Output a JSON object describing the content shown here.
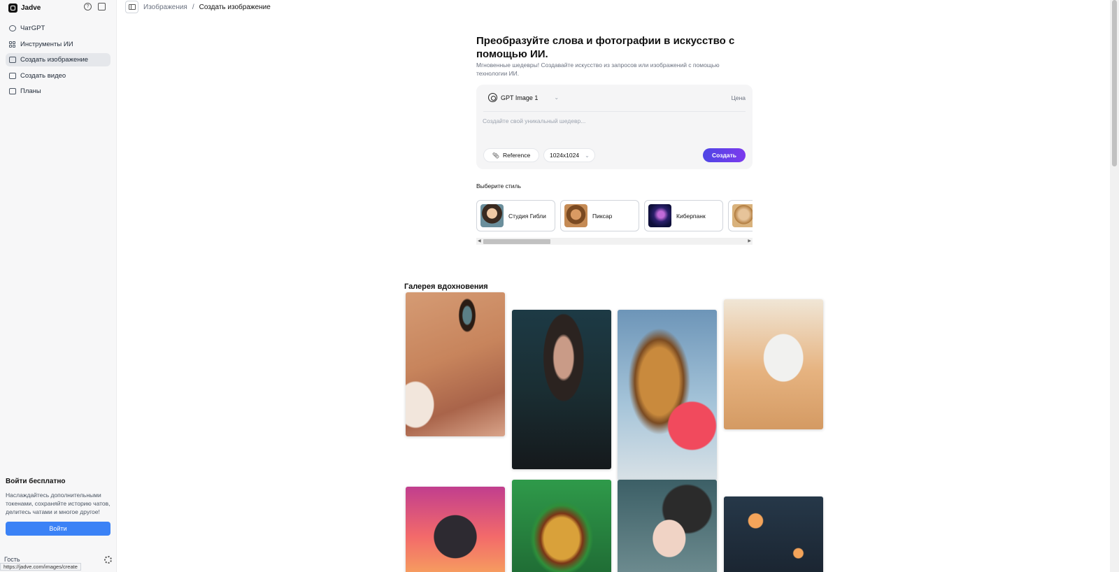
{
  "brand": {
    "name": "Jadve"
  },
  "sidebar": {
    "items": [
      {
        "label": "ЧатGPT",
        "icon": "chat-icon"
      },
      {
        "label": "Инструменты ИИ",
        "icon": "grid-icon"
      },
      {
        "label": "Создать изображение",
        "icon": "image-icon",
        "active": true
      },
      {
        "label": "Создать видео",
        "icon": "video-icon"
      },
      {
        "label": "Планы",
        "icon": "plans-icon"
      }
    ],
    "login": {
      "title": "Войти бесплатно",
      "text": "Наслаждайтесь дополнительными токенами, сохраняйте историю чатов, делитесь чатами и многое другое!",
      "button": "Войти"
    },
    "user": "Гость",
    "status_url": "https://jadve.com/images/create"
  },
  "breadcrumb": {
    "parent": "Изображения",
    "separator": "/",
    "current": "Создать изображение"
  },
  "hero": {
    "title": "Преобразуйте слова и фотографии в искусство с помощью ИИ.",
    "subtitle": "Мгновенные шедевры! Создавайте искусство из запросов или изображений с помощью технологии ИИ."
  },
  "prompt": {
    "model": "GPT Image 1",
    "price_label": "Цена",
    "placeholder": "Создайте свой уникальный шедевр...",
    "reference_label": "Reference",
    "size": "1024x1024",
    "create_label": "Создать"
  },
  "styles": {
    "label": "Выберите стиль",
    "items": [
      {
        "name": "Студия Гибли"
      },
      {
        "name": "Пиксар"
      },
      {
        "name": "Киберпанк"
      },
      {
        "name": ""
      }
    ]
  },
  "gallery": {
    "title": "Галерея вдохновения"
  },
  "colors": {
    "accent": "#3b82f6",
    "create_gradient_start": "#4f46e5",
    "create_gradient_end": "#7c3aed"
  }
}
